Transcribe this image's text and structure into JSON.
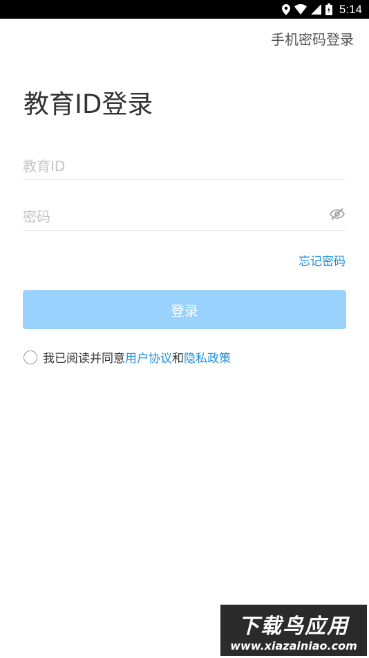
{
  "status_bar": {
    "time": "5:14"
  },
  "header": {
    "alt_login_link": "手机密码登录"
  },
  "main": {
    "title": "教育ID登录",
    "id_field": {
      "value": "",
      "placeholder": "教育ID"
    },
    "password_field": {
      "value": "",
      "placeholder": "密码"
    },
    "forgot_link": "忘记密码",
    "login_button": "登录",
    "agreement": {
      "checked": false,
      "prefix": "我已阅读并同意",
      "user_agreement": "用户协议",
      "conjunction": "和",
      "privacy_policy": "隐私政策"
    }
  },
  "watermark": {
    "title": "下载鸟应用",
    "url": "www.xiazainiao.com"
  },
  "colors": {
    "accent": "#1c8ede",
    "button_disabled": "#99d2fc",
    "status_bar": "#000000"
  }
}
